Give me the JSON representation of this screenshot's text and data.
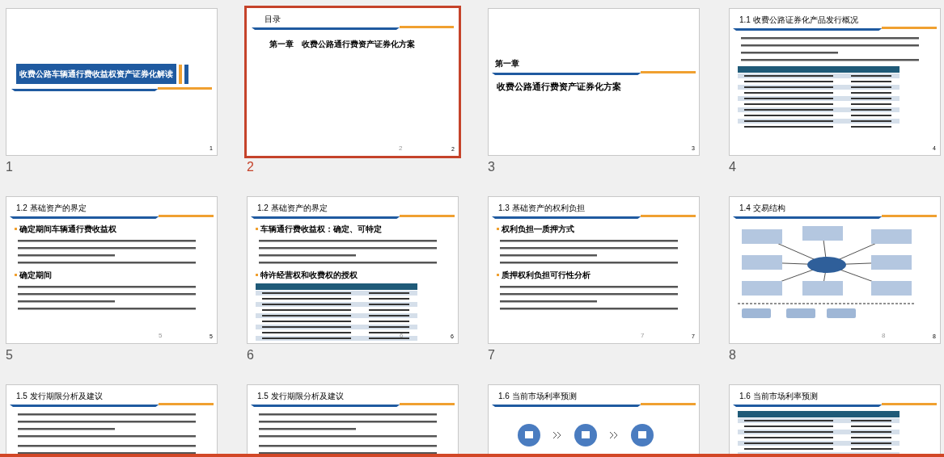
{
  "slides": [
    {
      "number": "1",
      "selected": false,
      "kind": "cover",
      "title": "收费公路车辆通行费收益权资产证券化解读",
      "page_number": "1"
    },
    {
      "number": "2",
      "selected": true,
      "kind": "toc",
      "title": "目录",
      "entries": [
        "第一章　收费公路通行费资产证券化方案"
      ],
      "footer_number": "2",
      "page_number": "2"
    },
    {
      "number": "3",
      "selected": false,
      "kind": "section",
      "label": "第一章",
      "title": "收费公路通行费资产证券化方案",
      "page_number": "3"
    },
    {
      "number": "4",
      "selected": false,
      "kind": "content",
      "title": "1.1 收费公路证券化产品发行概况",
      "blocks": [
        {
          "kind": "lines"
        },
        {
          "kind": "table"
        }
      ],
      "page_number": "4"
    },
    {
      "number": "5",
      "selected": false,
      "kind": "content",
      "title": "1.2 基础资产的界定",
      "blocks": [
        {
          "kind": "bullet",
          "text": "确定期间车辆通行费收益权"
        },
        {
          "kind": "lines"
        },
        {
          "kind": "bullet",
          "text": "确定期间"
        },
        {
          "kind": "lines"
        }
      ],
      "footer_number": "5",
      "page_number": "5"
    },
    {
      "number": "6",
      "selected": false,
      "kind": "content",
      "title": "1.2 基础资产的界定",
      "blocks": [
        {
          "kind": "bullet",
          "text": "车辆通行费收益权：确定、可特定"
        },
        {
          "kind": "lines"
        },
        {
          "kind": "bullet",
          "text": "特许经营权和收费权的授权"
        },
        {
          "kind": "table"
        }
      ],
      "footer_number": "6",
      "page_number": "6"
    },
    {
      "number": "7",
      "selected": false,
      "kind": "content",
      "title": "1.3 基础资产的权利负担",
      "blocks": [
        {
          "kind": "bullet",
          "text": "权利负担—质押方式"
        },
        {
          "kind": "lines"
        },
        {
          "kind": "bullet",
          "text": "质押权利负担可行性分析"
        },
        {
          "kind": "lines"
        }
      ],
      "footer_number": "7",
      "page_number": "7"
    },
    {
      "number": "8",
      "selected": false,
      "kind": "content",
      "title": "1.4 交易结构",
      "blocks": [
        {
          "kind": "diagram"
        }
      ],
      "footer_number": "8",
      "page_number": "8"
    },
    {
      "selected": false,
      "kind": "content",
      "title": "1.5 发行期限分析及建议",
      "blocks": [
        {
          "kind": "lines"
        },
        {
          "kind": "lines"
        }
      ]
    },
    {
      "selected": false,
      "kind": "content",
      "title": "1.5 发行期限分析及建议",
      "blocks": [
        {
          "kind": "lines"
        },
        {
          "kind": "lines"
        }
      ]
    },
    {
      "selected": false,
      "kind": "content",
      "title": "1.6 当前市场利率预测",
      "blocks": [
        {
          "kind": "icons"
        }
      ]
    },
    {
      "selected": false,
      "kind": "content",
      "title": "1.6 当前市场利率预测",
      "blocks": [
        {
          "kind": "table"
        }
      ]
    }
  ]
}
